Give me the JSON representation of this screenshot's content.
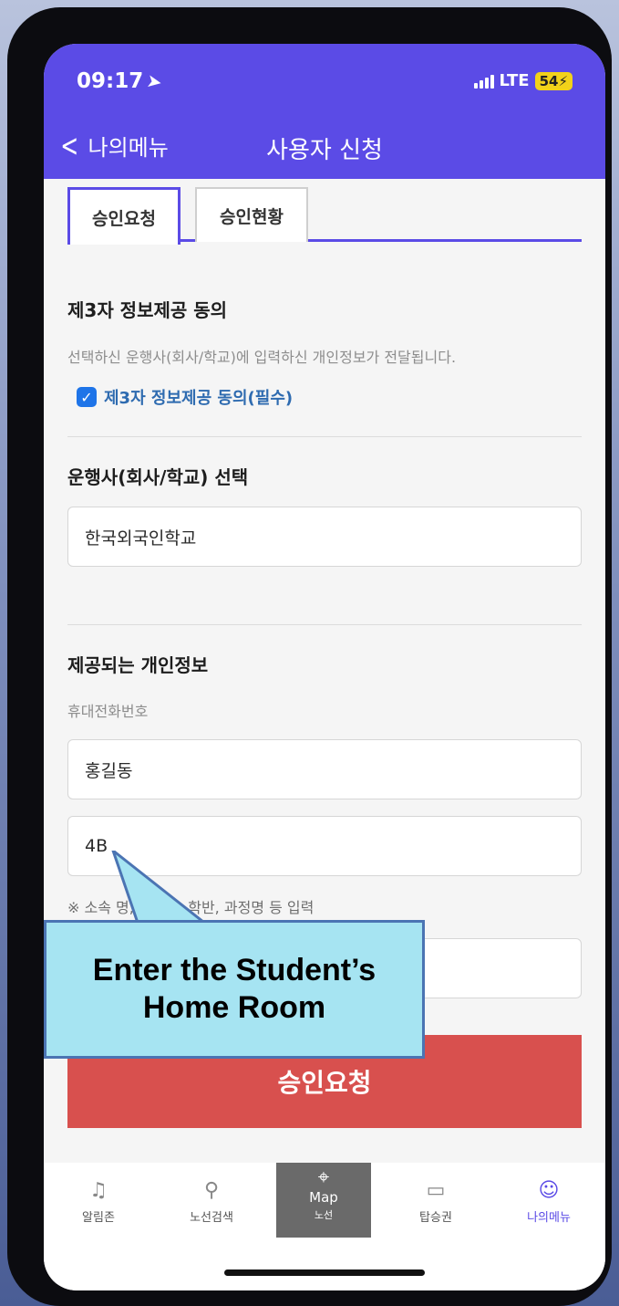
{
  "status_bar": {
    "time": "09:17",
    "network": "LTE",
    "battery": "54"
  },
  "header": {
    "back_label": "나의메뉴",
    "title": "사용자 신청"
  },
  "tabs": [
    {
      "label": "승인요청",
      "active": true
    },
    {
      "label": "승인현황",
      "active": false
    }
  ],
  "consent_section": {
    "title": "제3자 정보제공 동의",
    "description": "선택하신 운행사(회사/학교)에 입력하신 개인정보가 전달됩니다.",
    "checkbox_label": "제3자 정보제공 동의(필수)",
    "checked": true
  },
  "operator_section": {
    "title": "운행사(회사/학교) 선택",
    "selected": "한국외국인학교"
  },
  "personal_info_section": {
    "title": "제공되는 개인정보",
    "phone_label": "휴대전화번호",
    "name_value": "홍길동",
    "homeroom_value": "4B",
    "note": "※ 소속 명, 부서명, 학반, 과정명 등 입력"
  },
  "submit_label": "승인요청",
  "callout_text": "Enter the Student’s Home Room",
  "bottom_nav": {
    "alarm": "알림존",
    "route_search": "노선검색",
    "map": "Map",
    "map_sub": "노선",
    "ticket": "탑승권",
    "my_menu": "나의메뉴"
  },
  "colors": {
    "accent": "#5b4be6",
    "submit": "#d8504e",
    "callout": "#a6e4f2",
    "link": "#2e6bb0"
  }
}
